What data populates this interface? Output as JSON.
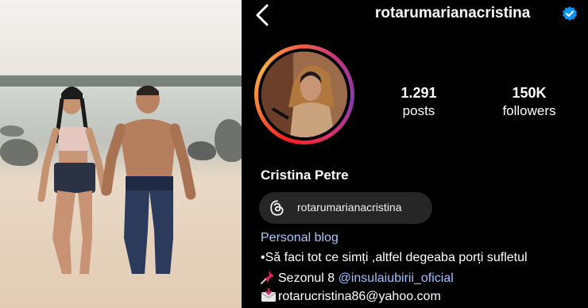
{
  "profile": {
    "username": "rotarumarianacristina",
    "full_name": "Cristina Petre",
    "verified": true,
    "stats": [
      {
        "value": "1.291",
        "label": "posts"
      },
      {
        "value": "150K",
        "label": "followers"
      }
    ],
    "threads_handle": "rotarumarianacristina",
    "category": "Personal blog",
    "bio_line1": "•Să faci tot ce simți ,altfel degeaba porți sufletul",
    "bio_line2_prefix": "Sezonul 8 ",
    "bio_line2_mention": "@insulaiubirii_oficial",
    "bio_line3": "rotarucristina86@yahoo.com"
  },
  "icons": {
    "back": "chevron-left-icon",
    "verified": "verified-badge-icon",
    "threads": "threads-icon",
    "pin": "pushpin-icon",
    "mail": "incoming-envelope-icon"
  },
  "colors": {
    "background": "#000000",
    "verified_blue": "#0095f6",
    "link_blue": "#9ec2ff",
    "category_blue": "#a8c7fa",
    "pill_background": "#262626"
  }
}
